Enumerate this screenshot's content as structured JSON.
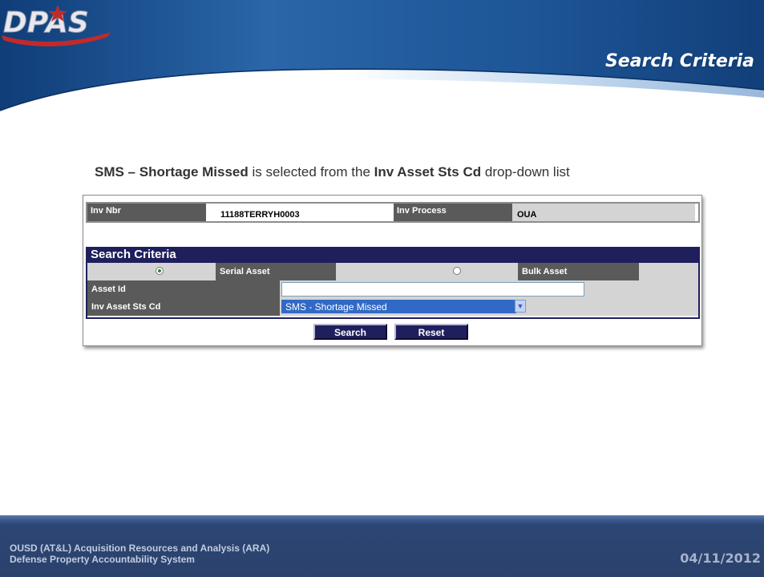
{
  "header": {
    "logo_text": "DPAS",
    "section_title": "Search Criteria"
  },
  "caption": {
    "bold_1": "SMS – Shortage Missed",
    "text_1": " is selected from the ",
    "bold_2": "Inv Asset Sts Cd",
    "text_2": " drop-down list"
  },
  "inventory": {
    "inv_nbr_label": "Inv Nbr",
    "inv_nbr_value": "11188TERRYH0003",
    "inv_process_label": "Inv Process",
    "inv_process_value": "OUA"
  },
  "search_criteria": {
    "title": "Search Criteria",
    "serial_asset_label": "Serial Asset",
    "bulk_asset_label": "Bulk Asset",
    "serial_selected": true,
    "asset_id_label": "Asset Id",
    "asset_id_value": "",
    "inv_asset_sts_cd_label": "Inv Asset Sts Cd",
    "inv_asset_sts_cd_selected": "SMS - Shortage Missed"
  },
  "buttons": {
    "search": "Search",
    "reset": "Reset"
  },
  "footer": {
    "org_line_1": "OUSD (AT&L) Acquisition Resources and Analysis (ARA)",
    "org_line_2": "Defense Property Accountability System",
    "date": "04/11/2012"
  },
  "colors": {
    "header_blue": "#1e4f8f",
    "panel_navy": "#1f1f5e",
    "label_grey": "#5a5a5a",
    "select_highlight": "#3169c6"
  }
}
